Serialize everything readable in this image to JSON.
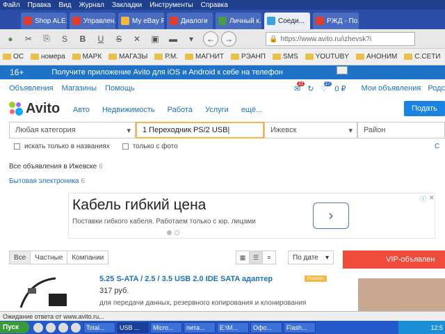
{
  "browser": {
    "menu": [
      "Файл",
      "Правка",
      "Вид",
      "Журнал",
      "Закладки",
      "Инструменты",
      "Справка"
    ],
    "tabs": [
      {
        "label": "Shop ALE1...",
        "color": "#e23c2c"
      },
      {
        "label": "Управлен...",
        "color": "#e23c2c"
      },
      {
        "label": "My eBay P...",
        "color": "#f5b740"
      },
      {
        "label": "Диалоги",
        "color": "#e23c2c"
      },
      {
        "label": "Личный к...",
        "color": "#4a9a4a"
      },
      {
        "label": "Соеди...",
        "color": "#3aa1d9",
        "active": true
      },
      {
        "label": "РЖД - По...",
        "color": "#e23c2c"
      }
    ],
    "url": "https://www.avito.ru/izhevsk?i",
    "bookmarks": [
      "ОС",
      "номера",
      "МАРК",
      "МАГАЗЫ",
      "Р.М.",
      "МАГНИТ",
      "РЭАНП",
      "SMS",
      "YOUTUBY",
      "АНОНИМ",
      "С.СЕТИ"
    ]
  },
  "app_banner": {
    "age": "16+",
    "text": "Получите приложение Avito для iOS и Android к себе на телефон"
  },
  "site_nav": {
    "links": [
      "Объявления",
      "Магазины",
      "Помощь"
    ],
    "msg_badge": "11",
    "fav_badge": "17",
    "balance": "0 ₽",
    "my_ads": "Мои объявления",
    "cut": "Родс"
  },
  "logo": {
    "word": "Avito",
    "colors": [
      "#97cf26",
      "#a169f7",
      "#ff6163",
      "#0af"
    ]
  },
  "categories": [
    "Авто",
    "Недвижимость",
    "Работа",
    "Услуги",
    "ещё..."
  ],
  "post_button": "Подать",
  "search": {
    "category": "Любая категория",
    "query": "1 Переходник PS/2 USB",
    "city": "Ижевск",
    "area": "Район",
    "check_titles": "искать только в названиях",
    "check_photo": "только с фото",
    "check_cut": "С"
  },
  "breadcrumbs": {
    "all": "Все объявления в Ижевске",
    "all_count": "6",
    "electronics": "Бытовая электроника",
    "electronics_count": "6"
  },
  "ad": {
    "headline": "Кабель гибкий цена",
    "sub": "Поставки гибкого кабеля. Работаем только с юр. лицами",
    "arrow": "›",
    "choices": "ⓘ",
    "close": "✕"
  },
  "filters": [
    "Все",
    "Частные",
    "Компании"
  ],
  "sort": "По дате",
  "vip": "VIP-объявлен",
  "listing": {
    "title": "5.25 S-ATA / 2.5 / 3.5 USB 2.0 IDE SATA адаптер",
    "price": "317 руб.",
    "desc": "для передачи данных, резервного копирования и клонирования",
    "badge": "Premium"
  },
  "status": "Ожидание ответа от www.avito.ru...",
  "taskbar": {
    "start": "Пуск",
    "tasks": [
      "Total...",
      "USB ...",
      "Micro...",
      "питa...",
      "E:\\M...",
      "Офо...",
      "Flash..."
    ],
    "clock": "12:5"
  }
}
